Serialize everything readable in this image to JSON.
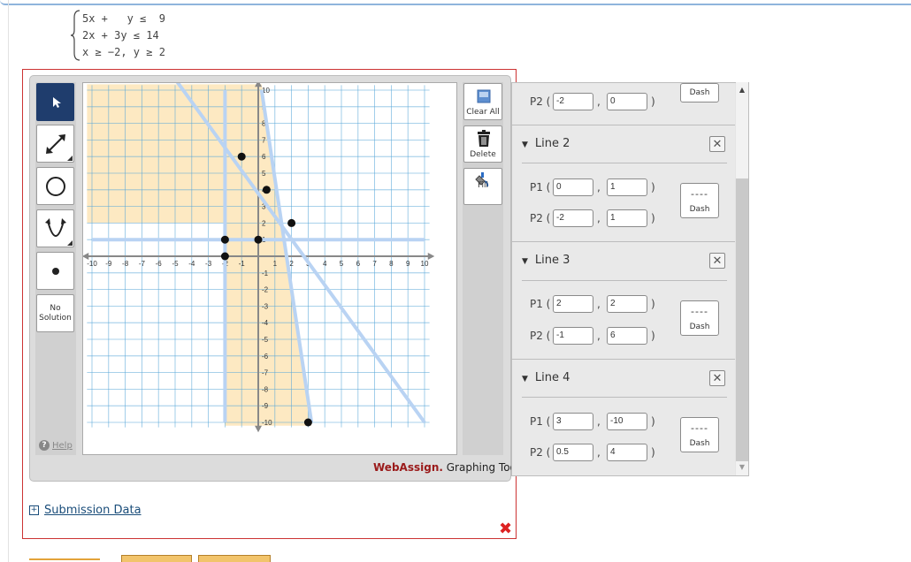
{
  "system": {
    "lines": [
      "5x +   y ≤  9",
      "2x + 3y ≤ 14",
      "x ≥ −2, y ≥ 2"
    ]
  },
  "toolbar_left": {
    "tools": [
      {
        "name": "pointer-icon"
      },
      {
        "name": "line-icon"
      },
      {
        "name": "circle-icon"
      },
      {
        "name": "parabola-icon"
      },
      {
        "name": "point-icon"
      }
    ],
    "no_solution_label_1": "No",
    "no_solution_label_2": "Solution",
    "help_label": "Help",
    "help_icon": "?"
  },
  "toolbar_right": {
    "clear_all_label": "Clear All",
    "delete_label": "Delete",
    "fill_label": "Fill"
  },
  "graph": {
    "xlim": [
      -10,
      10
    ],
    "ylim": [
      -10,
      10
    ],
    "x_ticks": [
      "-10",
      "-9",
      "-8",
      "-7",
      "-6",
      "-5",
      "-4",
      "-3",
      "-2",
      "-1",
      "1",
      "2",
      "3",
      "4",
      "5",
      "6",
      "7",
      "8",
      "9",
      "10"
    ],
    "y_ticks": [
      "10",
      "9",
      "8",
      "7",
      "6",
      "5",
      "4",
      "3",
      "2",
      "1",
      "-1",
      "-2",
      "-3",
      "-4",
      "-5",
      "-6",
      "-7",
      "-8",
      "-9",
      "-10"
    ],
    "lines": [
      {
        "p1": [
          -2,
          10
        ],
        "p2": [
          -2,
          -10
        ]
      },
      {
        "p1": [
          -10,
          1
        ],
        "p2": [
          10,
          1
        ]
      },
      {
        "p1": [
          -5,
          10.667
        ],
        "p2": [
          10,
          -10
        ]
      },
      {
        "p1": [
          0.2,
          10
        ],
        "p2": [
          3.2,
          -10
        ]
      }
    ],
    "points": [
      [
        -1,
        6
      ],
      [
        0.5,
        4
      ],
      [
        2,
        2
      ],
      [
        -2,
        1
      ],
      [
        0,
        1
      ],
      [
        -2,
        0
      ],
      [
        3,
        -10
      ]
    ],
    "colors": {
      "fill": "#fde9c2",
      "grid": "#5aa8d8",
      "boundary": "#b9d3f3",
      "point": "#111111",
      "axis": "#888888"
    }
  },
  "brand": {
    "part1": "WebAssign.",
    "part2": " Graphing Tool"
  },
  "side_panel": {
    "top_dash_label": "Dash",
    "line1_p2": {
      "x": "-2",
      "y": "0"
    },
    "lines": [
      {
        "title": "Line 2",
        "p1": {
          "x": "0",
          "y": "1"
        },
        "p2": {
          "x": "-2",
          "y": "1"
        },
        "dash_label": "Dash",
        "dash_lines": "----"
      },
      {
        "title": "Line 3",
        "p1": {
          "x": "2",
          "y": "2"
        },
        "p2": {
          "x": "-1",
          "y": "6"
        },
        "dash_label": "Dash",
        "dash_lines": "----"
      },
      {
        "title": "Line 4",
        "p1": {
          "x": "3",
          "y": "-10"
        },
        "p2": {
          "x": "0.5",
          "y": "4"
        },
        "dash_label": "Dash",
        "dash_lines": "----"
      }
    ],
    "p1_label": "P1 (",
    "p2_label": "P2 (",
    "close_paren": ")",
    "comma": ","
  },
  "footer": {
    "submission_label": "Submission Data",
    "expand_icon": "+",
    "close_icon_glyph": "✖"
  }
}
